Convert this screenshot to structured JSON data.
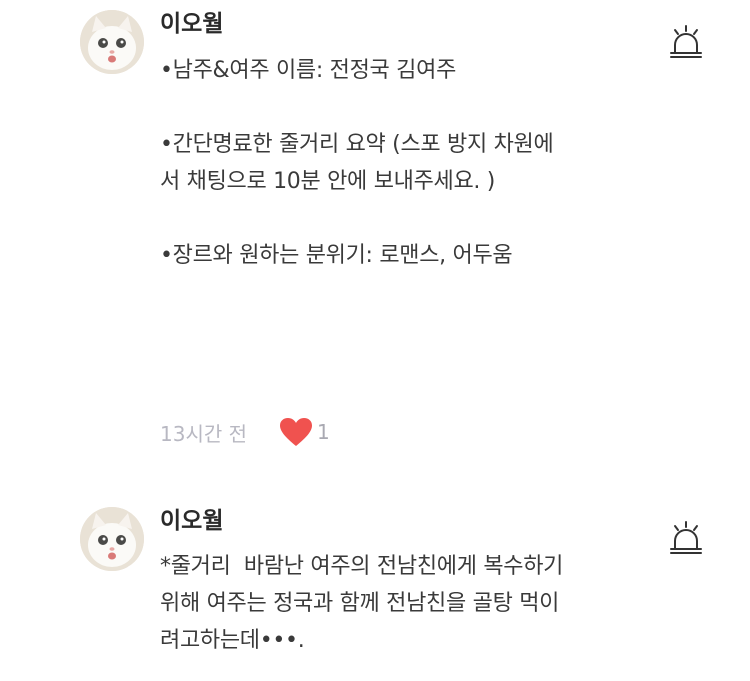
{
  "comments": [
    {
      "username": "이오월",
      "avatar": "white-kitten-photo",
      "body": "•남주&여주 이름: 전정국 김여주\n\n•간단명료한 줄거리 요약 (스포 방지 차원에\n서 채팅으로 10분 안에 보내주세요. )\n\n•장르와 원하는 분위기: 로맨스, 어두움",
      "time": "13시간 전",
      "likes": "1",
      "heart_color": "#f0524f",
      "report_icon": "siren-icon"
    },
    {
      "username": "이오월",
      "avatar": "white-kitten-photo",
      "body": "*줄거리  바람난 여주의 전남친에게 복수하기\n위해 여주는 정국과 함께 전남친을 골탕 먹이\n려고하는데•••.",
      "report_icon": "siren-icon"
    }
  ]
}
